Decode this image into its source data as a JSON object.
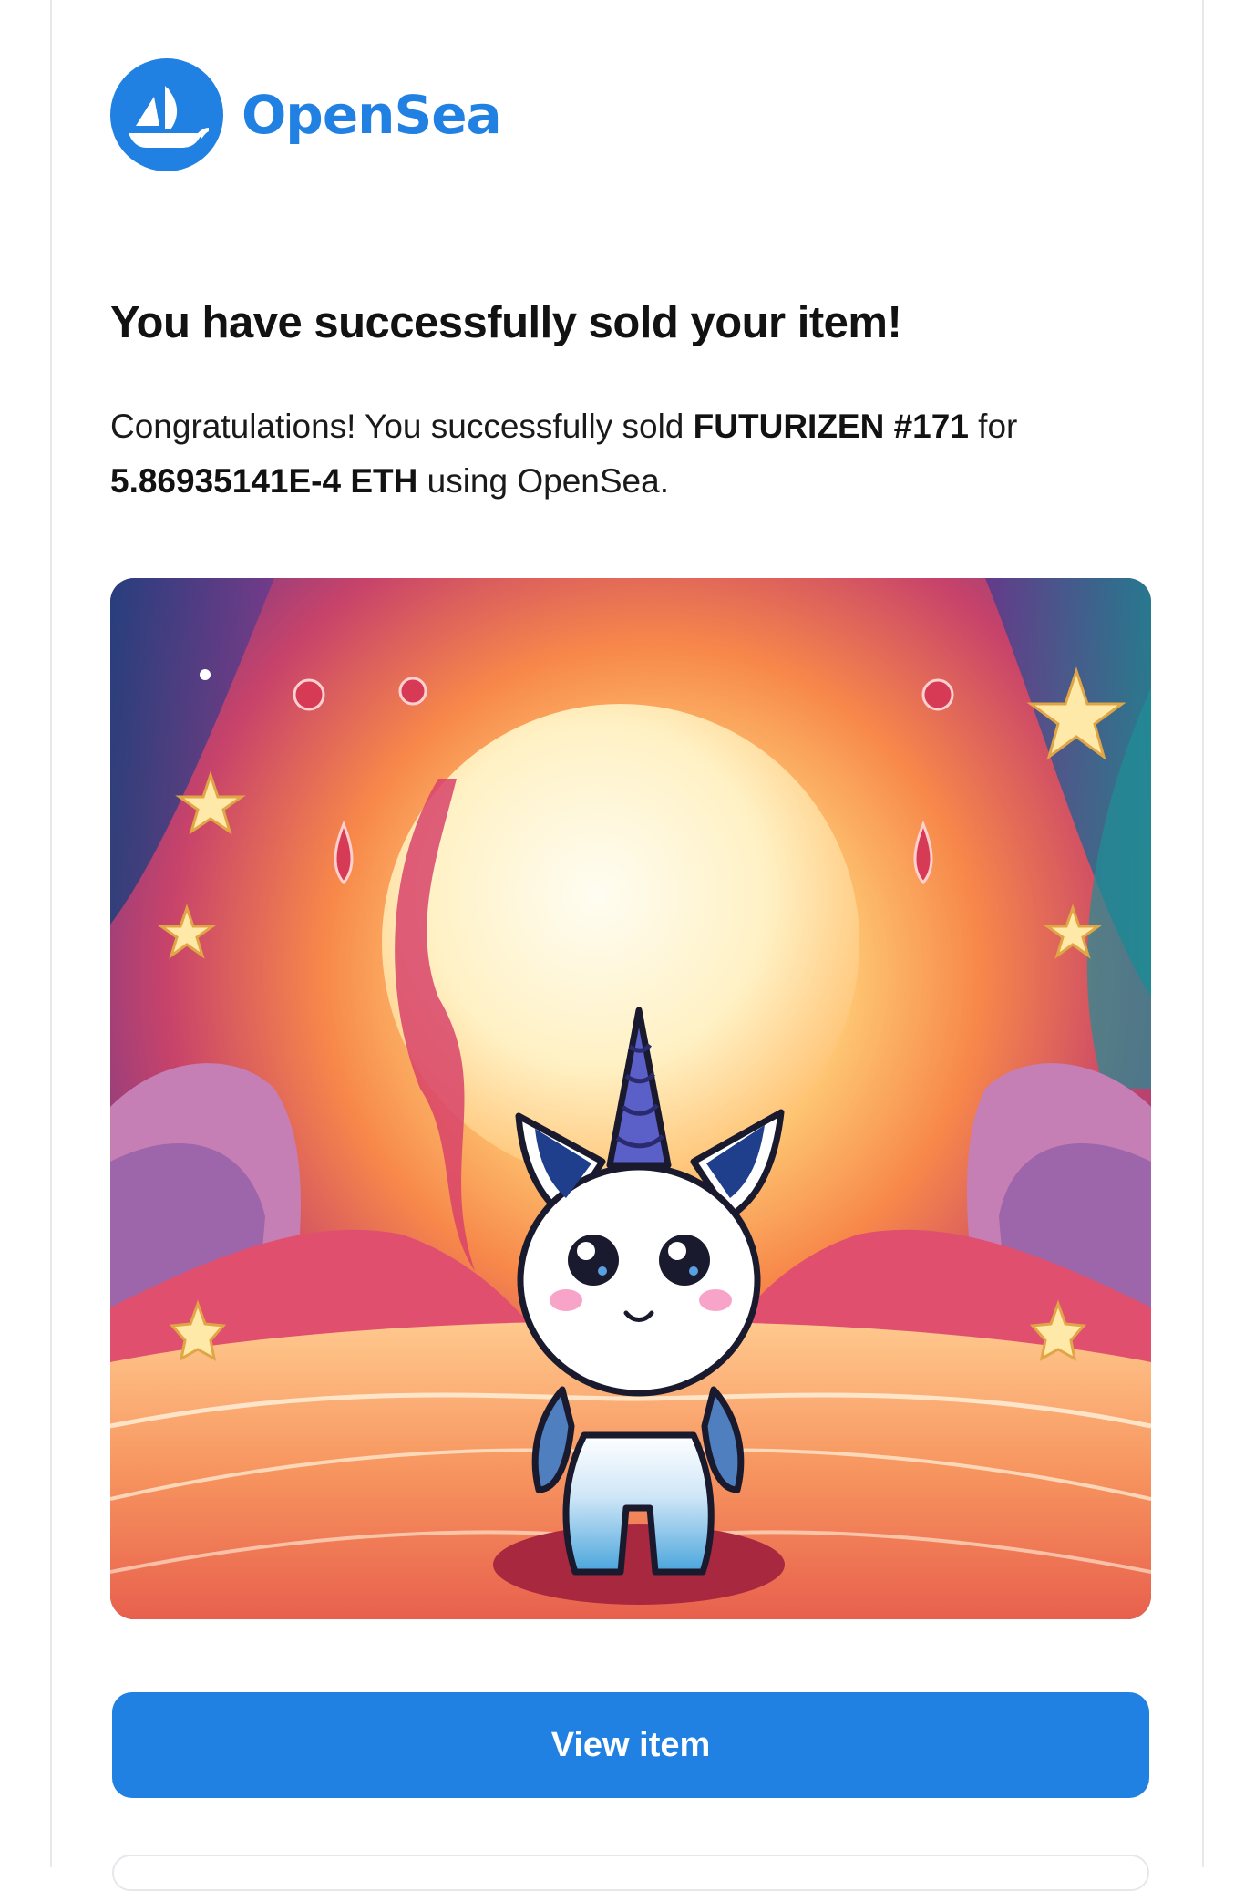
{
  "brand": {
    "name": "OpenSea",
    "logo_icon": "opensea-boat-icon",
    "color": "#2081e2"
  },
  "email": {
    "heading": "You have successfully sold your item!",
    "message": {
      "intro": "Congratulations! You successfully sold ",
      "item_name": "FUTURIZEN #171",
      "for_text": " for",
      "price": "5.86935141E-4 ETH",
      "outro": " using OpenSea."
    },
    "image_subject": "cartoon-unicorn-nft-image",
    "view_button_label": "View item"
  },
  "colors": {
    "button_bg": "#2081e2",
    "button_text": "#ffffff",
    "heading_text": "#121212"
  }
}
